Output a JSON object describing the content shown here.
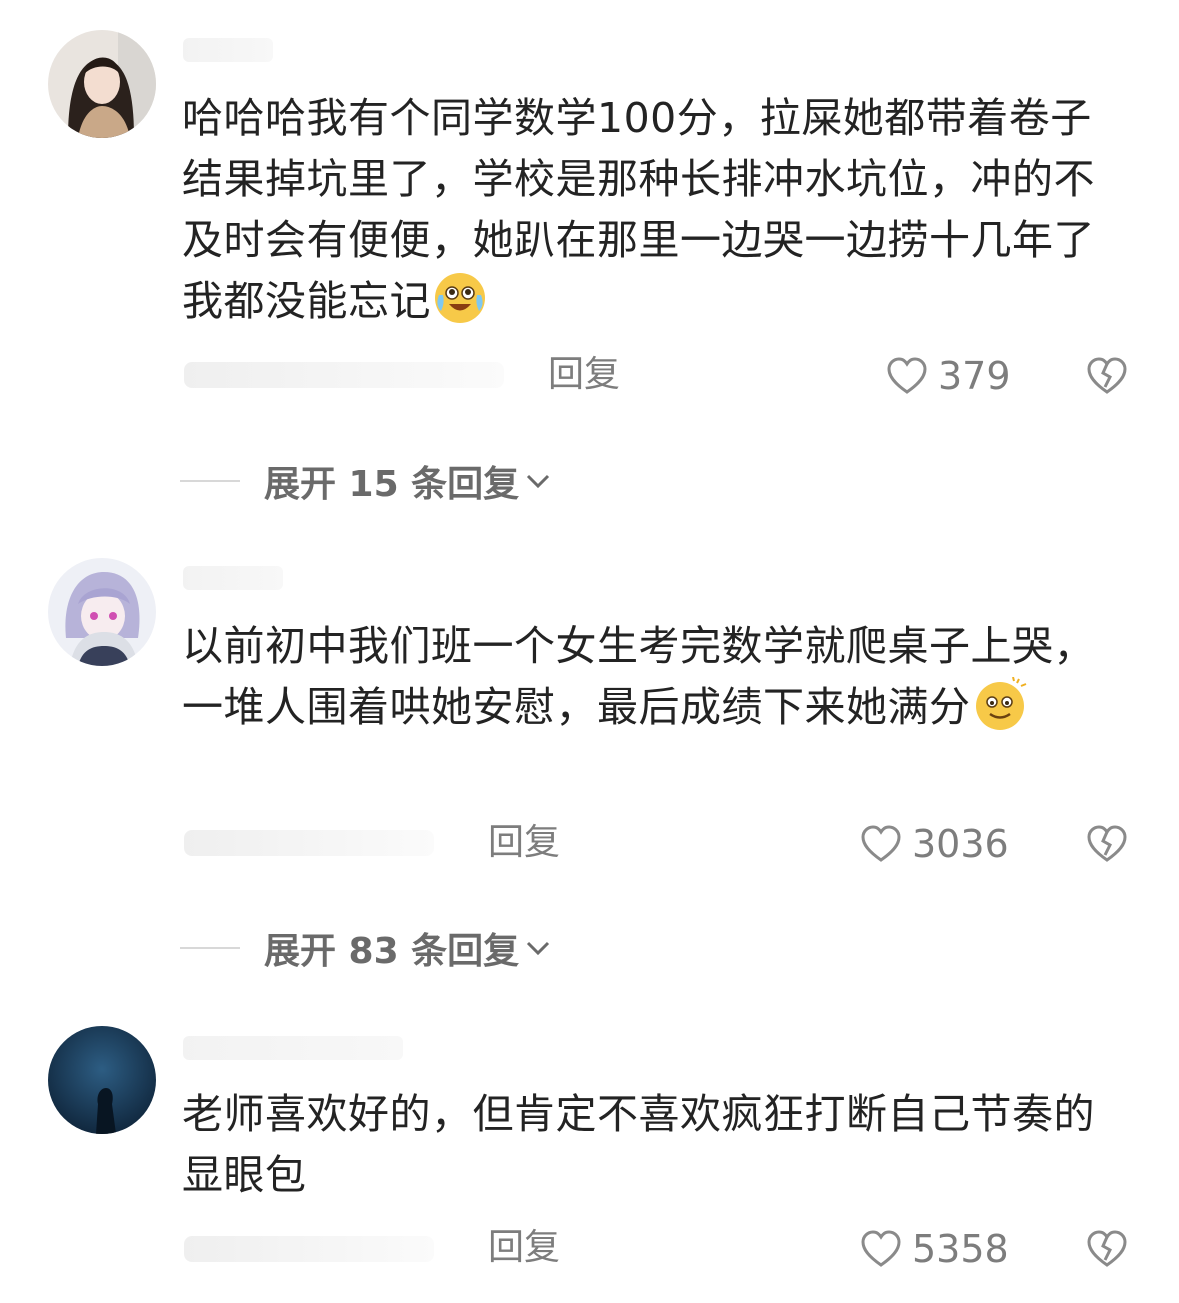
{
  "comments": [
    {
      "text": "哈哈哈我有个同学数学100分，拉屎她都带着卷子结果掉坑里了，学校是那种长排冲水坑位，冲的不及时会有便便，她趴在那里一边哭一边捞十几年了我都没能忘记",
      "emoji": "crying-laughing-emoji",
      "reply_label": "回复",
      "likes": "379",
      "expand_label": "展开 15 条回复"
    },
    {
      "text": "以前初中我们班一个女生考完数学就爬桌子上哭，一堆人围着哄她安慰，最后成绩下来她满分",
      "emoji": "dizzy-smile-emoji",
      "reply_label": "回复",
      "likes": "3036",
      "expand_label": "展开 83 条回复"
    },
    {
      "text": "老师喜欢好的，但肯定不喜欢疯狂打断自己节奏的显眼包",
      "reply_label": "回复",
      "likes": "5358"
    }
  ],
  "colors": {
    "text": "#232323",
    "secondary": "#7d7d7d",
    "divider": "#d8d8d8",
    "background": "#ffffff"
  }
}
